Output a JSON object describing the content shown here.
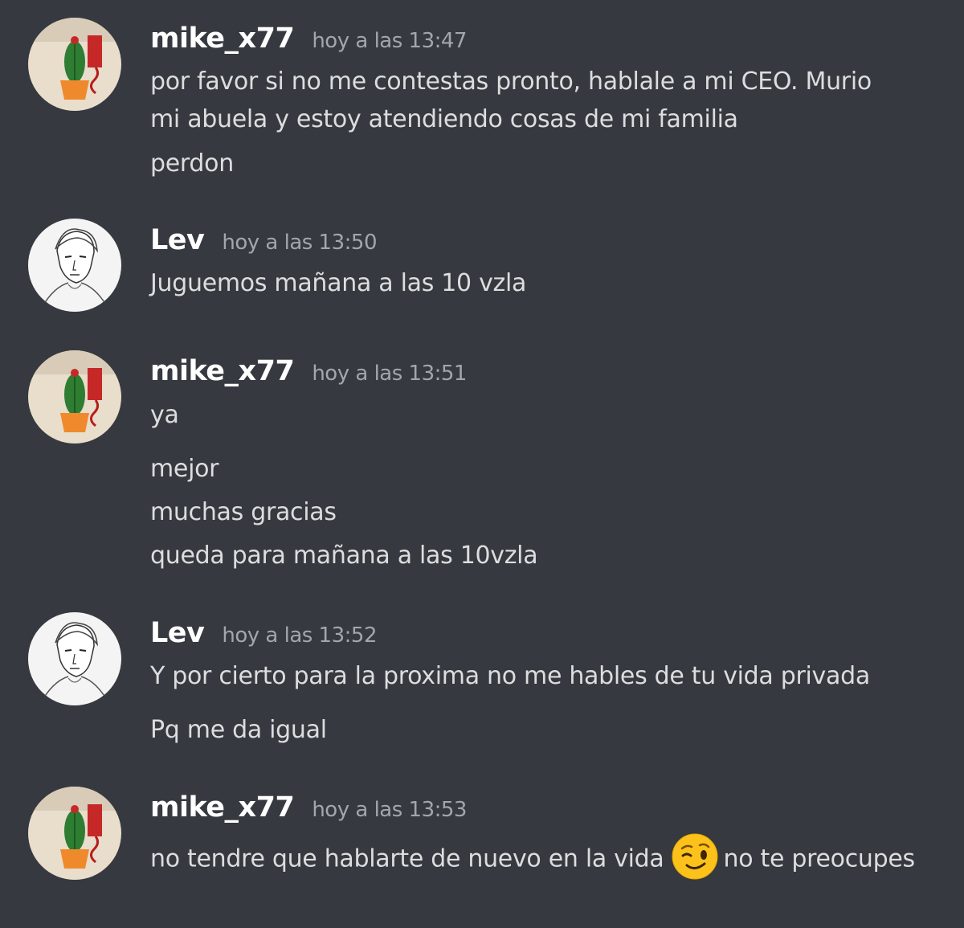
{
  "messages": [
    {
      "author": "mike_x77",
      "timestamp": "hoy a las 13:47",
      "avatar": "cactus-avatar",
      "lines": [
        "por favor si no me contestas pronto, hablale a mi CEO. Murio",
        "mi abuela y estoy atendiendo cosas de mi familia",
        "perdon"
      ]
    },
    {
      "author": "Lev",
      "timestamp": "hoy a las 13:50",
      "avatar": "sketch-portrait-avatar",
      "lines": [
        "Juguemos mañana a las 10 vzla"
      ]
    },
    {
      "author": "mike_x77",
      "timestamp": "hoy a las 13:51",
      "avatar": "cactus-avatar",
      "lines": [
        "ya",
        "mejor",
        "muchas gracias",
        "queda para mañana a las 10vzla"
      ]
    },
    {
      "author": "Lev",
      "timestamp": "hoy a las 13:52",
      "avatar": "sketch-portrait-avatar",
      "lines": [
        "Y por cierto para la proxima no me hables de tu vida privada",
        "Pq me da igual"
      ]
    },
    {
      "author": "mike_x77",
      "timestamp": "hoy a las 13:53",
      "avatar": "cactus-avatar",
      "lines": [
        "no tendre que hablarte de nuevo en la vida",
        "no te preocupes"
      ],
      "emoji": "winking-face-emoji"
    }
  ],
  "colors": {
    "background": "#36393f",
    "username": "#ffffff",
    "timestamp": "#a3a6aa",
    "message_text": "#dcddde",
    "emoji_yellow": "#fcc21b"
  }
}
